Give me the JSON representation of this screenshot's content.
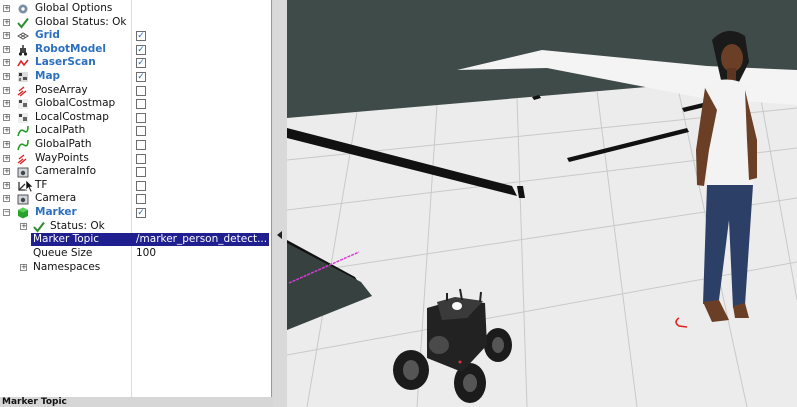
{
  "displays": [
    {
      "label": "Global Options",
      "bold": false,
      "icon": "gear-icon",
      "checkbox": null
    },
    {
      "label": "Global Status: Ok",
      "bold": false,
      "icon": "check-icon",
      "checkbox": null
    },
    {
      "label": "Grid",
      "bold": true,
      "icon": "grid-icon",
      "checkbox": true
    },
    {
      "label": "RobotModel",
      "bold": true,
      "icon": "robot-model-icon",
      "checkbox": true
    },
    {
      "label": "LaserScan",
      "bold": true,
      "icon": "laser-scan-icon",
      "checkbox": true
    },
    {
      "label": "Map",
      "bold": true,
      "icon": "map-icon",
      "checkbox": true
    },
    {
      "label": "PoseArray",
      "bold": false,
      "icon": "pose-array-icon",
      "checkbox": false
    },
    {
      "label": "GlobalCostmap",
      "bold": false,
      "icon": "costmap-icon",
      "checkbox": false
    },
    {
      "label": "LocalCostmap",
      "bold": false,
      "icon": "costmap-icon",
      "checkbox": false
    },
    {
      "label": "LocalPath",
      "bold": false,
      "icon": "path-icon",
      "checkbox": false
    },
    {
      "label": "GlobalPath",
      "bold": false,
      "icon": "path-icon",
      "checkbox": false
    },
    {
      "label": "WayPoints",
      "bold": false,
      "icon": "pose-array-icon",
      "checkbox": false
    },
    {
      "label": "CameraInfo",
      "bold": false,
      "icon": "camera-icon",
      "checkbox": false
    },
    {
      "label": "TF",
      "bold": false,
      "icon": "tf-icon",
      "checkbox": false
    },
    {
      "label": "Camera",
      "bold": false,
      "icon": "camera-icon",
      "checkbox": false
    },
    {
      "label": "Marker",
      "bold": true,
      "icon": "marker-icon",
      "checkbox": true
    }
  ],
  "marker_properties": {
    "status": "Status: Ok",
    "topic_key": "Marker Topic",
    "topic_value": "/marker_person_detect...",
    "queue_key": "Queue Size",
    "queue_value": "100",
    "namespaces_key": "Namespaces"
  },
  "description_title": "Marker Topic",
  "colors": {
    "selection": "#1f1f8f",
    "bold_label": "#2c6fbf",
    "grid_floor": "#eeeeee",
    "background": "#3e4a48",
    "marker_line": "#d63bd6",
    "person_marker": "#e02020"
  }
}
